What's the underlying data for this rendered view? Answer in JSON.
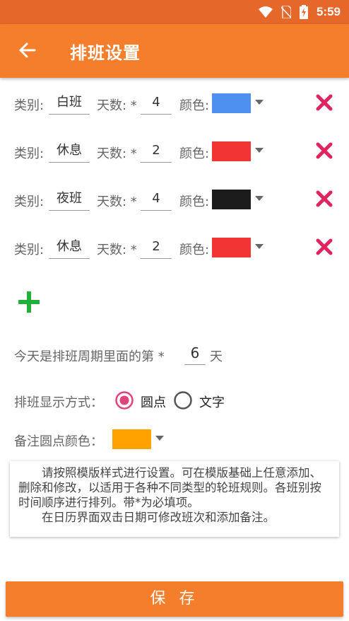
{
  "status_bar": {
    "time": "5:59",
    "icons": [
      "wifi-icon",
      "no-sim-icon",
      "battery-charging-icon"
    ]
  },
  "header": {
    "title": "排班设置",
    "back_icon": "arrow-left-icon"
  },
  "colors": {
    "app_bar": "#f47e2c",
    "status_bar": "#e5672a",
    "delete": "#e0245e",
    "add": "#22b03c",
    "radio": "#e0457b"
  },
  "shifts": [
    {
      "category_label": "类别:",
      "category": "白班",
      "days_label": "天数: *",
      "days": "4",
      "color_label": "颜色:",
      "color": "#4d90f0"
    },
    {
      "category_label": "类别:",
      "category": "休息",
      "days_label": "天数: *",
      "days": "2",
      "color_label": "颜色:",
      "color": "#f23534"
    },
    {
      "category_label": "类别:",
      "category": "夜班",
      "days_label": "天数: *",
      "days": "4",
      "color_label": "颜色:",
      "color": "#1c1c1c"
    },
    {
      "category_label": "类别:",
      "category": "休息",
      "days_label": "天数: *",
      "days": "2",
      "color_label": "颜色:",
      "color": "#f23534"
    }
  ],
  "today": {
    "prefix": "今天是排班周期里面的第 *",
    "value": "6",
    "suffix": "天"
  },
  "display_mode": {
    "label": "排班显示方式：",
    "options": [
      "圆点",
      "文字"
    ],
    "selected": "圆点"
  },
  "dot_color": {
    "label": "备注圆点颜色：",
    "color": "#ffa200"
  },
  "note": {
    "line1": "请按照模版样式进行设置。可在模版基础上任意添加、删除和修改，以适用于各种不同类型的轮班规则。各班别按时间顺序进行排列。带*为必填项。",
    "line2": "在日历界面双击日期可修改班次和添加备注。"
  },
  "save_label": "保 存"
}
